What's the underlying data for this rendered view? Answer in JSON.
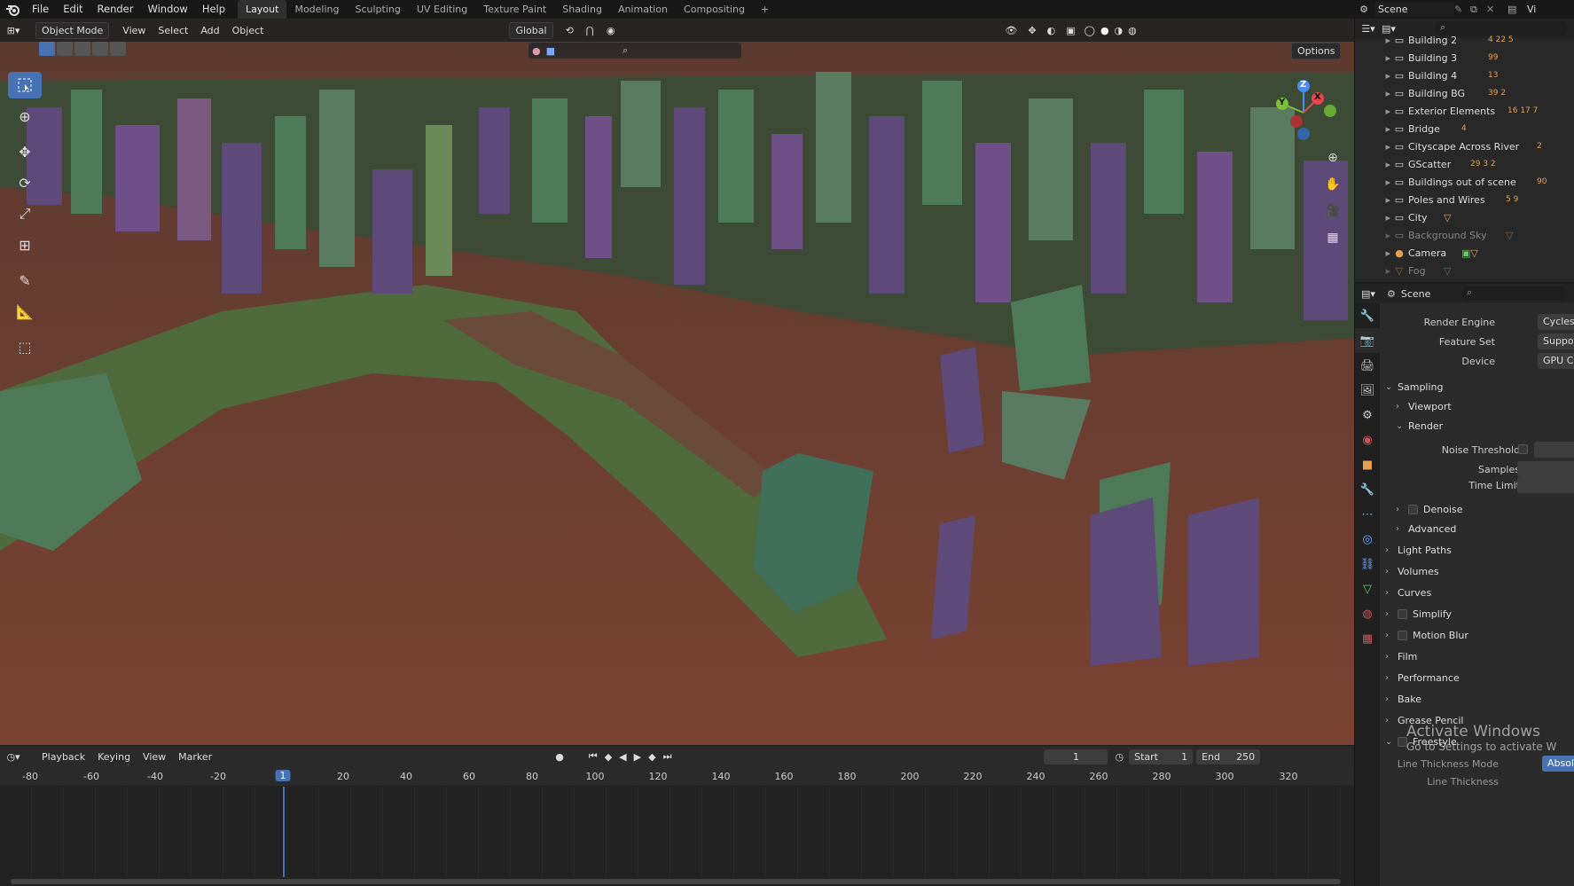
{
  "topbar": {
    "menus": [
      "File",
      "Edit",
      "Render",
      "Window",
      "Help"
    ],
    "workspaces": [
      "Layout",
      "Modeling",
      "Sculpting",
      "UV Editing",
      "Texture Paint",
      "Shading",
      "Animation",
      "Compositing"
    ],
    "add_tab": "+",
    "scene": "Scene",
    "view_layer": "Vi"
  },
  "viewport": {
    "mode": "Object Mode",
    "menus": [
      "View",
      "Select",
      "Add",
      "Object"
    ],
    "orientation": "Global",
    "options": "Options",
    "tools": [
      "select-box-icon",
      "cursor-icon",
      "move-icon",
      "rotate-icon",
      "scale-icon",
      "transform-icon",
      "annotate-icon",
      "measure-icon",
      "add-cube-icon"
    ],
    "gizmo": {
      "z": "Z",
      "y": "Y",
      "x": "X"
    }
  },
  "timeline": {
    "menus": [
      "Playback",
      "Keying",
      "View",
      "Marker"
    ],
    "current_frame": "1",
    "start_label": "Start",
    "start": "1",
    "end_label": "End",
    "end": "250",
    "ticks": [
      "-80",
      "-60",
      "-40",
      "-20",
      "1",
      "20",
      "40",
      "60",
      "80",
      "100",
      "120",
      "140",
      "160",
      "180",
      "200",
      "220",
      "240",
      "260",
      "280",
      "300",
      "320"
    ]
  },
  "outliner": {
    "rows": [
      {
        "name": "Building 2",
        "badges": "4 22 5"
      },
      {
        "name": "Building 3",
        "badges": "99"
      },
      {
        "name": "Building 4",
        "badges": "13"
      },
      {
        "name": "Building BG",
        "badges": "39 2"
      },
      {
        "name": "Exterior Elements",
        "badges": "16 17 7"
      },
      {
        "name": "Bridge",
        "badges": "4"
      },
      {
        "name": "Cityscape Across River",
        "badges": "2"
      },
      {
        "name": "GScatter",
        "badges": "29 3 2"
      },
      {
        "name": "Buildings out of scene",
        "badges": "90"
      },
      {
        "name": "Poles and Wires",
        "badges": "5 9"
      },
      {
        "name": "City",
        "badges": ""
      },
      {
        "name": "Background Sky",
        "badges": ""
      },
      {
        "name": "Camera",
        "badges": ""
      },
      {
        "name": "Fog",
        "badges": ""
      }
    ]
  },
  "properties": {
    "scene": "Scene",
    "render_engine_label": "Render Engine",
    "render_engine": "Cycles",
    "feature_set_label": "Feature Set",
    "feature_set": "Supported",
    "device_label": "Device",
    "device": "GPU Compu",
    "sampling": "Sampling",
    "viewport": "Viewport",
    "render": "Render",
    "noise_threshold": "Noise Threshold",
    "samples": "Samples",
    "time_limit": "Time Limit",
    "denoise": "Denoise",
    "advanced": "Advanced",
    "sections": [
      "Light Paths",
      "Volumes",
      "Curves",
      "Simplify",
      "Motion Blur",
      "Film",
      "Performance",
      "Bake",
      "Grease Pencil",
      "Freestyle"
    ],
    "line_thickness_mode": "Line Thickness Mode",
    "line_thickness_mode_value": "Absolu",
    "line_thickness": "Line Thickness"
  },
  "watermark": {
    "title": "Activate Windows",
    "sub": "Go to Settings to activate W"
  },
  "colors": {
    "accent": "#4772b3",
    "ground": "#6b3a2e",
    "terrain": "#4a6a3a",
    "building_purple": "#5d4a78",
    "building_green": "#4f7a5a"
  }
}
